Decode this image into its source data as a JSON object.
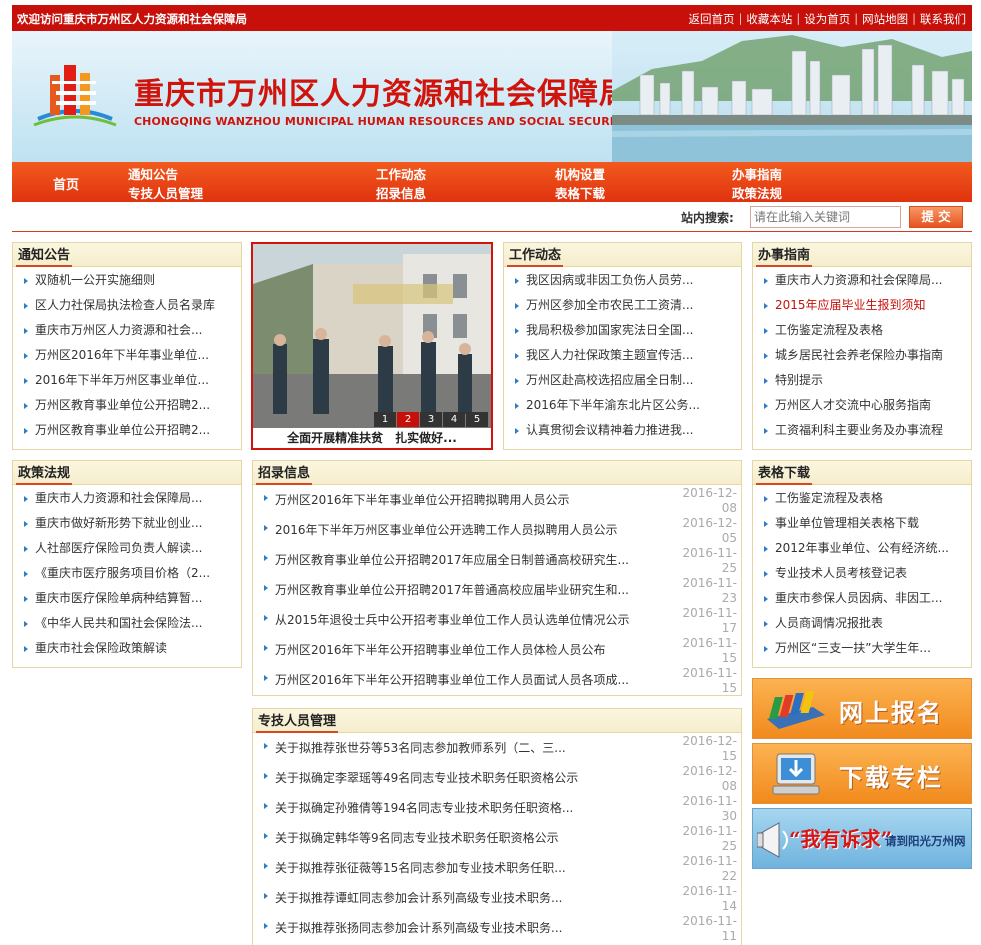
{
  "topbar": {
    "welcome": "欢迎访问重庆市万州区人力资源和社会保障局",
    "links": [
      "返回首页",
      "收藏本站",
      "设为首页",
      "网站地图",
      "联系我们"
    ]
  },
  "banner": {
    "title": "重庆市万州区人力资源和社会保障局",
    "subtitle": "CHONGQING WANZHOU MUNICIPAL HUMAN RESOURCES AND SOCIAL SECURITY BUREAU"
  },
  "nav": {
    "home": "首页",
    "row1": [
      "通知公告",
      "工作动态",
      "机构设置",
      "办事指南"
    ],
    "row2": [
      "专技人员管理",
      "招录信息",
      "表格下载",
      "政策法规"
    ]
  },
  "search": {
    "label": "站内搜索:",
    "placeholder": "请在此输入关键词",
    "button": "提 交"
  },
  "notice": {
    "title": "通知公告",
    "items": [
      "双随机一公开实施细则",
      "区人力社保局执法检查人员名录库",
      "重庆市万州区人力资源和社会...",
      "万州区2016年下半年事业单位...",
      "2016年下半年万州区事业单位...",
      "万州区教育事业单位公开招聘2...",
      "万州区教育事业单位公开招聘2..."
    ]
  },
  "photo": {
    "caption": "全面开展精准扶贫　扎实做好...",
    "pages": [
      "1",
      "2",
      "3",
      "4",
      "5"
    ],
    "active": "2"
  },
  "work": {
    "title": "工作动态",
    "items": [
      "我区因病或非因工负伤人员劳...",
      "万州区参加全市农民工工资清...",
      "我局积极参加国家宪法日全国...",
      "我区人力社保政策主题宣传活...",
      "万州区赴高校选招应届全日制...",
      "2016年下半年渝东北片区公务...",
      "认真贯彻会议精神着力推进我..."
    ]
  },
  "guide": {
    "title": "办事指南",
    "items": [
      "重庆市人力资源和社会保障局...",
      "2015年应届毕业生报到须知",
      "工伤鉴定流程及表格",
      "城乡居民社会养老保险办事指南",
      "特别提示",
      "万州区人才交流中心服务指南",
      "工资福利科主要业务及办事流程"
    ]
  },
  "policy": {
    "title": "政策法规",
    "items": [
      "重庆市人力资源和社会保障局...",
      "重庆市做好新形势下就业创业...",
      "人社部医疗保险司负责人解读...",
      "《重庆市医疗服务项目价格（2...",
      "重庆市医疗保险单病种结算暂...",
      "《中华人民共和国社会保险法...",
      "重庆市社会保险政策解读"
    ]
  },
  "recruit": {
    "title": "招录信息",
    "items": [
      {
        "text": "万州区2016年下半年事业单位公开招聘拟聘用人员公示",
        "date": "2016-12-08"
      },
      {
        "text": "2016年下半年万州区事业单位公开选聘工作人员拟聘用人员公示",
        "date": "2016-12-05"
      },
      {
        "text": "万州区教育事业单位公开招聘2017年应届全日制普通高校研究生...",
        "date": "2016-11-25"
      },
      {
        "text": "万州区教育事业单位公开招聘2017年普通高校应届毕业研究生和...",
        "date": "2016-11-23"
      },
      {
        "text": "从2015年退役士兵中公开招考事业单位工作人员认选单位情况公示",
        "date": "2016-11-17"
      },
      {
        "text": "万州区2016年下半年公开招聘事业单位工作人员体检人员公布",
        "date": "2016-11-15"
      },
      {
        "text": "万州区2016年下半年公开招聘事业单位工作人员面试人员各项成...",
        "date": "2016-11-15"
      }
    ]
  },
  "forms": {
    "title": "表格下载",
    "items": [
      "工伤鉴定流程及表格",
      "事业单位管理相关表格下载",
      "2012年事业单位、公有经济统...",
      "专业技术人员考核登记表",
      "重庆市参保人员因病、非因工...",
      "人员商调情况报批表",
      "万州区“三支一扶”大学生年..."
    ]
  },
  "staff": {
    "title": "专技人员管理",
    "items": [
      {
        "text": "关于拟推荐张世芬等53名同志参加教师系列（二、三...",
        "date": "2016-12-15"
      },
      {
        "text": "关于拟确定李翠瑶等49名同志专业技术职务任职资格公示",
        "date": "2016-12-08"
      },
      {
        "text": "关于拟确定孙雅倩等194名同志专业技术职务任职资格...",
        "date": "2016-11-30"
      },
      {
        "text": "关于拟确定韩华等9名同志专业技术职务任职资格公示",
        "date": "2016-11-25"
      },
      {
        "text": "关于拟推荐张征薇等15名同志参加专业技术职务任职...",
        "date": "2016-11-22"
      },
      {
        "text": "关于拟推荐谭虹同志参加会计系列高级专业技术职务...",
        "date": "2016-11-14"
      },
      {
        "text": "关于拟推荐张扬同志参加会计系列高级专业技术职务...",
        "date": "2016-11-11"
      }
    ]
  },
  "side": {
    "signup": "网上报名",
    "download": "下载专栏",
    "complain_main": "“我有诉求”",
    "complain_sub": "请到阳光万州网"
  },
  "colors": {
    "brand_red": "#c8100a",
    "nav_orange": "#f25a1e",
    "box_border": "#e6d6a6",
    "bullet_blue": "#2f7cc6"
  }
}
